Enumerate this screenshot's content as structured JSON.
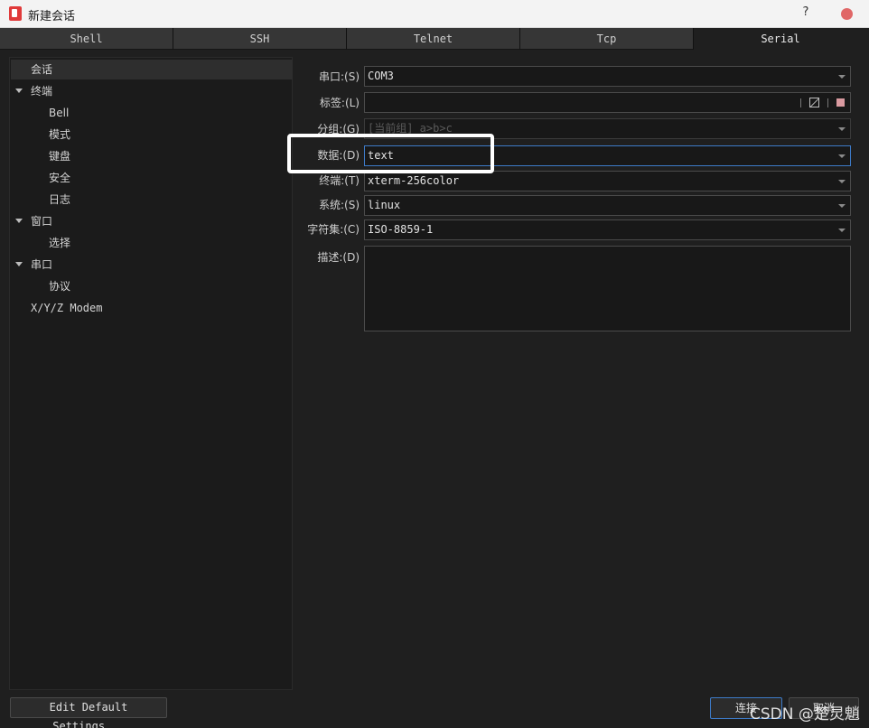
{
  "window": {
    "title": "新建会话",
    "help_label": "?",
    "app_icon": "session-app-icon",
    "close_color": "#e06767"
  },
  "tabs": [
    {
      "label": "Shell",
      "active": false
    },
    {
      "label": "SSH",
      "active": false
    },
    {
      "label": "Telnet",
      "active": false
    },
    {
      "label": "Tcp",
      "active": false
    },
    {
      "label": "Serial",
      "active": true
    }
  ],
  "tree": {
    "items": [
      {
        "label": "会话",
        "selected": true,
        "expandable": false
      },
      {
        "label": "终端",
        "selected": false,
        "expandable": true
      },
      {
        "label": "Bell",
        "selected": false,
        "expandable": false
      },
      {
        "label": "模式",
        "selected": false,
        "expandable": false
      },
      {
        "label": "键盘",
        "selected": false,
        "expandable": false
      },
      {
        "label": "安全",
        "selected": false,
        "expandable": false
      },
      {
        "label": "日志",
        "selected": false,
        "expandable": false
      },
      {
        "label": "窗口",
        "selected": false,
        "expandable": true
      },
      {
        "label": "选择",
        "selected": false,
        "expandable": false
      },
      {
        "label": "串口",
        "selected": false,
        "expandable": true
      },
      {
        "label": "协议",
        "selected": false,
        "expandable": false
      },
      {
        "label": "X/Y/Z Modem",
        "selected": false,
        "expandable": false
      }
    ]
  },
  "form": {
    "port": {
      "label": "串口:",
      "mnemonic": "(S)",
      "value": "COM3"
    },
    "tag": {
      "label": "标签:",
      "mnemonic": "(L)",
      "value": ""
    },
    "group": {
      "label": "分组:",
      "mnemonic": "(G)",
      "placeholder": "[当前组] a>b>c"
    },
    "data": {
      "label": "数据:",
      "mnemonic": "(D)",
      "value": "text"
    },
    "terminal": {
      "label": "终端:",
      "mnemonic": "(T)",
      "value": "xterm-256color"
    },
    "system": {
      "label": "系统:",
      "mnemonic": "(S)",
      "value": "linux"
    },
    "charset": {
      "label": "字符集:",
      "mnemonic": "(C)",
      "value": "ISO-8859-1"
    },
    "description": {
      "label": "描述:",
      "mnemonic": "(D)",
      "value": ""
    }
  },
  "buttons": {
    "edit_defaults": "Edit Default Settings...",
    "connect": "连接",
    "cancel": "取消"
  },
  "watermark": "CSDN @楚灵魈",
  "colors": {
    "focus_border": "#3d7ac7",
    "tag_color_swatch": "#d99aa0",
    "highlight_box": "#ffffff"
  }
}
